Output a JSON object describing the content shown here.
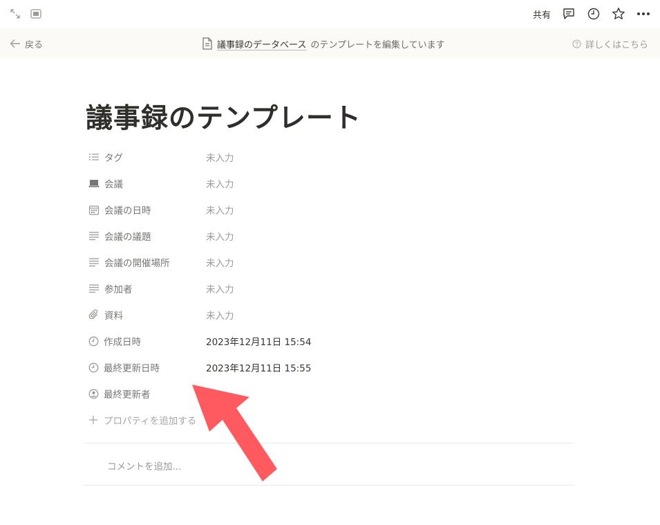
{
  "topbar": {
    "share_label": "共有",
    "icons": [
      "expand-icon",
      "sidebar-toggle-icon",
      "comment-icon",
      "clock-icon",
      "star-icon",
      "more-icon"
    ]
  },
  "banner": {
    "back_label": "戻る",
    "database_name": "議事録のデータベース",
    "editing_text": "のテンプレートを編集しています",
    "help_label": "詳しくはこちら"
  },
  "page": {
    "title": "議事録のテンプレート"
  },
  "properties": [
    {
      "icon": "list-icon",
      "label": "タグ",
      "value": "未入力"
    },
    {
      "icon": "laptop-icon",
      "label": "会議",
      "value": "未入力"
    },
    {
      "icon": "calendar-icon",
      "label": "会議の日時",
      "value": "未入力"
    },
    {
      "icon": "text-icon",
      "label": "会議の議題",
      "value": "未入力"
    },
    {
      "icon": "text-icon",
      "label": "会議の開催場所",
      "value": "未入力"
    },
    {
      "icon": "text-icon",
      "label": "参加者",
      "value": "未入力"
    },
    {
      "icon": "paperclip-icon",
      "label": "資料",
      "value": "未入力"
    },
    {
      "icon": "clock-icon",
      "label": "作成日時",
      "value": "2023年12月11日 15:54"
    },
    {
      "icon": "clock-icon",
      "label": "最終更新日時",
      "value": "2023年12月11日 15:55"
    },
    {
      "icon": "person-icon",
      "label": "最終更新者",
      "value": ""
    }
  ],
  "add_property_label": "プロパティを追加する",
  "comment_placeholder": "コメントを追加...",
  "colors": {
    "arrow": "#ff5a5f",
    "banner_bg": "#fbfaf7",
    "text_primary": "#37352f",
    "text_muted": "#9b9a97"
  }
}
